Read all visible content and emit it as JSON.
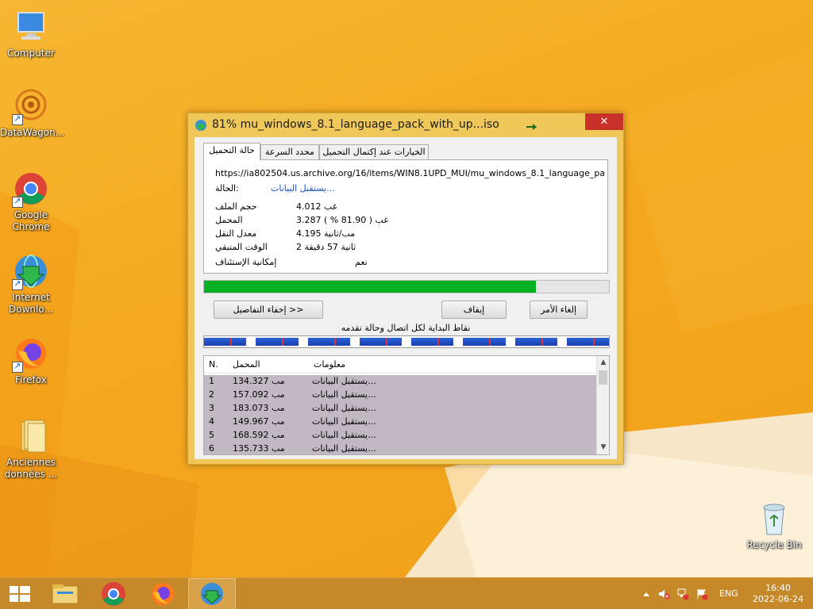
{
  "desktop": {
    "icons": [
      {
        "label": "Computer",
        "icon": "computer-icon"
      },
      {
        "label": "DataWagon...",
        "icon": "datawagon-icon"
      },
      {
        "label": "Google Chrome",
        "icon": "chrome-icon"
      },
      {
        "label": "Internet Downlo...",
        "icon": "idm-icon"
      },
      {
        "label": "Firefox",
        "icon": "firefox-icon"
      },
      {
        "label": "Anciennes données ...",
        "icon": "folder-icon"
      },
      {
        "label": "Recycle Bin",
        "icon": "recycle-bin-icon"
      }
    ]
  },
  "window": {
    "title": "81% mu_windows_8.1_language_pack_with_up...iso",
    "close_symbol": "✕",
    "tabs": [
      {
        "label": "حالة التحميل"
      },
      {
        "label": "محدد السرعة"
      },
      {
        "label": "الخيارات عند إكتمال التحميل"
      }
    ],
    "url": "https://ia802504.us.archive.org/16/items/WIN8.1UPD_MUI/mu_windows_8.1_language_pack_with_",
    "status_label": "الحالة:",
    "status_value": "يستقبل البيانات...",
    "info": [
      {
        "label": "حجم الملف",
        "value": "4.012  غب"
      },
      {
        "label": "المحمل",
        "value": "3.287  غب  ( 81.90 % )"
      },
      {
        "label": "معدل النقل",
        "value": "4.195  مب/ثانية"
      },
      {
        "label": "الوقت المتبقي",
        "value": "2 ثانية 57 دقيقة"
      },
      {
        "label": "إمكانية الإستئناف",
        "value": "نعم"
      }
    ],
    "progress": 0.819,
    "buttons": {
      "hide_details": "إخفاء التفاصيل >>",
      "pause": "إيقاف",
      "cancel": "إلغاء الأمر"
    },
    "connections_label": "نقاط البداية لكل اتصال وحالة تقدمه",
    "segments": 8,
    "list": {
      "columns": [
        "N.",
        "المحمل",
        "معلومات"
      ],
      "rows": [
        {
          "n": "1",
          "downloaded": "134.327  مب",
          "info": "يستقبل البيانات..."
        },
        {
          "n": "2",
          "downloaded": "157.092  مب",
          "info": "يستقبل البيانات..."
        },
        {
          "n": "3",
          "downloaded": "183.073  مب",
          "info": "يستقبل البيانات..."
        },
        {
          "n": "4",
          "downloaded": "149.967  مب",
          "info": "يستقبل البيانات..."
        },
        {
          "n": "5",
          "downloaded": "168.592  مب",
          "info": "يستقبل البيانات..."
        },
        {
          "n": "6",
          "downloaded": "135.733  مب",
          "info": "يستقبل البيانات..."
        }
      ]
    }
  },
  "taskbar": {
    "language": "ENG",
    "time": "16:40",
    "date": "2022-06-24"
  },
  "colors": {
    "progress_fill": "#06b025",
    "close_button": "#c7312a",
    "desktop": "#f4a81f"
  }
}
